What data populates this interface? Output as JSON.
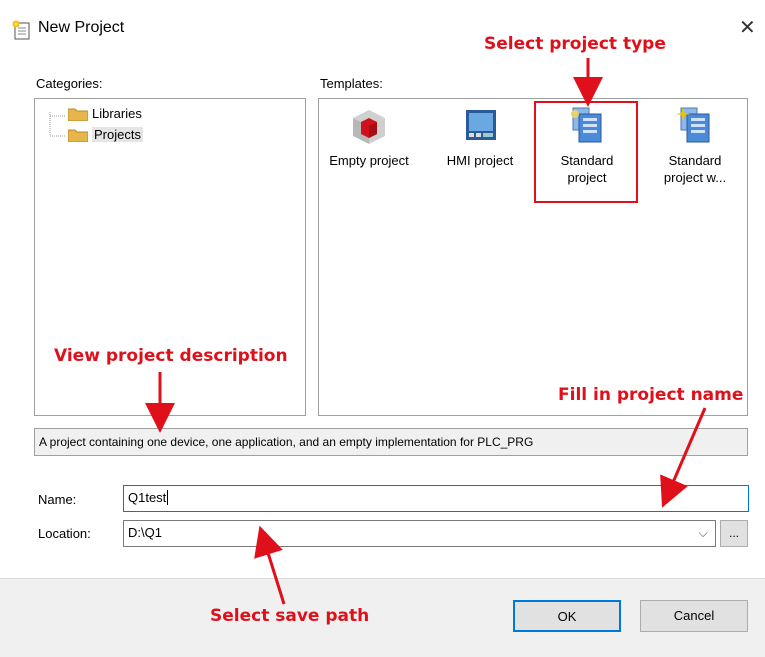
{
  "window": {
    "title": "New Project"
  },
  "categories": {
    "label": "Categories:",
    "items": [
      {
        "label": "Libraries"
      },
      {
        "label": "Projects"
      }
    ]
  },
  "templates": {
    "label": "Templates:",
    "items": [
      {
        "label": "Empty project"
      },
      {
        "label": "HMI project"
      },
      {
        "label": "Standard project"
      },
      {
        "label": "Standard project w..."
      }
    ]
  },
  "description": "A project containing one device, one application, and an empty implementation for PLC_PRG",
  "form": {
    "name_label": "Name:",
    "name_value": "Q1test",
    "location_label": "Location:",
    "location_value": "D:\\Q1",
    "browse_label": "..."
  },
  "buttons": {
    "ok": "OK",
    "cancel": "Cancel"
  },
  "annotations": {
    "select_type": "Select project type",
    "view_description": "View project description",
    "fill_name": "Fill in project name",
    "select_path": "Select save path"
  },
  "colors": {
    "annotation": "#e0101a",
    "selection_border": "#e0101a",
    "focus_border": "#0078d7"
  }
}
